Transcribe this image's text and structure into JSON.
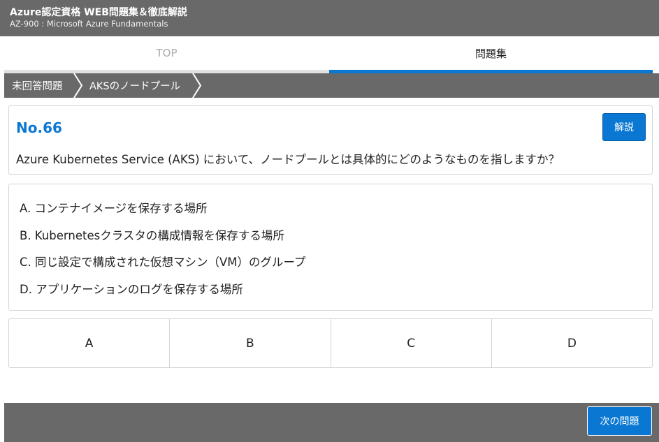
{
  "header": {
    "title": "Azure認定資格 WEB問題集＆徹底解説",
    "subtitle": "AZ-900 : Microsoft Azure Fundamentals"
  },
  "tabs": [
    {
      "label": "TOP",
      "active": false
    },
    {
      "label": "問題集",
      "active": true
    }
  ],
  "breadcrumb": [
    {
      "label": "未回答問題"
    },
    {
      "label": "AKSのノードプール"
    }
  ],
  "question": {
    "number": "No.66",
    "explain_label": "解説",
    "text": "Azure Kubernetes Service (AKS) において、ノードプールとは具体的にどのようなものを指しますか？"
  },
  "choices": [
    "A. コンテナイメージを保存する場所",
    "B. Kubernetesクラスタの構成情報を保存する場所",
    "C. 同じ設定で構成された仮想マシン（VM）のグループ",
    "D. アプリケーションのログを保存する場所"
  ],
  "answers": [
    "A",
    "B",
    "C",
    "D"
  ],
  "footer": {
    "next_label": "次の問題"
  },
  "colors": {
    "header_bg": "#696969",
    "accent": "#0a78d2",
    "border": "#d4d4d4"
  }
}
